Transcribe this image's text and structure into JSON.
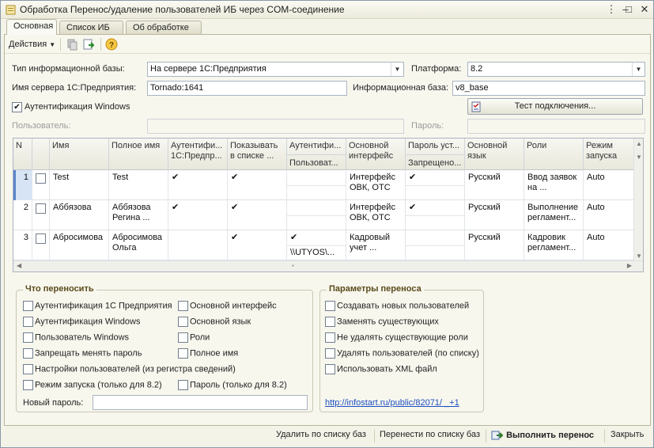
{
  "window": {
    "title": "Обработка  Перенос/удаление пользователей ИБ через COM-соединение"
  },
  "tabs": [
    {
      "label": "Основная"
    },
    {
      "label": "Список ИБ"
    },
    {
      "label": "Об обработке"
    }
  ],
  "toolbar": {
    "actions_label": "Действия"
  },
  "form": {
    "ib_type_label": "Тип информационной базы:",
    "ib_type_value": "На сервере 1С:Предприятия",
    "platform_label": "Платформа:",
    "platform_value": "8.2",
    "server_label": "Имя сервера 1С:Предприятия:",
    "server_value": "Tornado:1641",
    "ib_label": "Информационная база:",
    "ib_value": "v8_base",
    "win_auth_label": "Аутентификация Windows",
    "test_button": "Тест подключения...",
    "user_label": "Пользователь:",
    "password_label": "Пароль:"
  },
  "table": {
    "headers": {
      "n": "N",
      "name": "Имя",
      "fullname": "Полное имя",
      "auth1c": "Аутентифи... 1С:Предпр...",
      "show": "Показывать в списке ...",
      "authwin": "Аутентифи...",
      "authwin_sub": "Пользоват...",
      "iface": "Основной интерфейс",
      "pwd": "Пароль уст...",
      "pwd_sub": "Запрещено...",
      "lang": "Основной язык",
      "roles": "Роли",
      "mode": "Режим запуска"
    },
    "rows": [
      {
        "n": "1",
        "name": "Test",
        "fullname": "Test",
        "auth1c": "✔",
        "show": "✔",
        "authwin": "",
        "authwin_user": "",
        "iface": "Интерфейс ОВК, ОТС",
        "pwd": "✔",
        "pwd_forbid": "",
        "lang": "Русский",
        "roles": "Ввод заявок на ...",
        "mode": "Auto"
      },
      {
        "n": "2",
        "name": "Аббязова",
        "fullname": "Аббязова Регина ...",
        "auth1c": "✔",
        "show": "✔",
        "authwin": "",
        "authwin_user": "",
        "iface": "Интерфейс ОВК, ОТС",
        "pwd": "✔",
        "pwd_forbid": "",
        "lang": "Русский",
        "roles": "Выполнение регламент...",
        "mode": "Auto"
      },
      {
        "n": "3",
        "name": "Абросимова",
        "fullname": "Абросимова Ольга",
        "auth1c": "",
        "show": "✔",
        "authwin": "✔",
        "authwin_user": "\\\\UTYOS\\...",
        "iface": "Кадровый учет ...",
        "pwd": "",
        "pwd_forbid": "",
        "lang": "Русский",
        "roles": "Кадровик регламент...",
        "mode": "Auto"
      }
    ]
  },
  "transfer": {
    "title": "Что переносить",
    "opts": {
      "auth1c": "Аутентификация 1С Предприятия",
      "iface": "Основной интерфейс",
      "authwin": "Аутентификация Windows",
      "lang": "Основной язык",
      "winuser": "Пользователь Windows",
      "roles": "Роли",
      "forbid": "Запрещать менять пароль",
      "fullname": "Полное имя",
      "settings": "Настройки пользователей (из регистра сведений)",
      "mode": "Режим запуска (только для 8.2)",
      "pwd": "Пароль (только для 8.2)"
    },
    "new_pwd_label": "Новый пароль:"
  },
  "params": {
    "title": "Параметры переноса",
    "opts": {
      "create": "Создавать новых пользователей",
      "replace": "Заменять существующих",
      "nodelete": "Не удалять существующие роли",
      "delete": "Удалять пользователей (по списку)",
      "xml": "Использовать XML файл"
    },
    "link": "http://infostart.ru/public/82071/ _+1"
  },
  "bottom": {
    "delete": "Удалить по списку баз",
    "transfer": "Перенести по списку баз",
    "run": "Выполнить перенос",
    "close": "Закрыть"
  }
}
